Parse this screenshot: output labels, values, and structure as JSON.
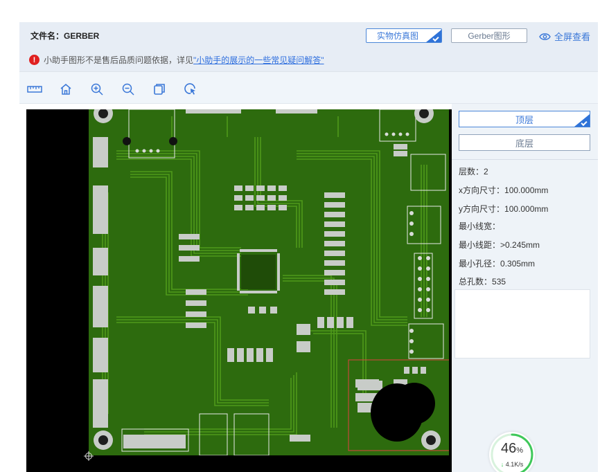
{
  "header": {
    "file_name": "文件名：GERBER",
    "notice_text": "小助手图形不是售后品质问题依据，详见",
    "notice_link": "\"小助手的展示的一些常见疑问解答\"",
    "notice_icon": "warning-icon"
  },
  "view_buttons": {
    "sim_label": "实物仿真图",
    "gerber_label": "Gerber图形",
    "fullscreen_label": "全屏查看"
  },
  "toolbar": {
    "icons": [
      "ruler-icon",
      "home-icon",
      "zoom-in-icon",
      "zoom-out-icon",
      "copy-icon",
      "pointer-refresh-icon"
    ]
  },
  "layers": {
    "top_label": "顶层",
    "bottom_label": "底层"
  },
  "info": [
    {
      "label": "层数：",
      "value": "2"
    },
    {
      "label": "x方向尺寸：",
      "value": "100.000mm"
    },
    {
      "label": "y方向尺寸：",
      "value": "100.000mm"
    },
    {
      "label": "最小线宽：",
      "value": ""
    },
    {
      "label": "最小线距：",
      "value": ">0.245mm"
    },
    {
      "label": "最小孔径：",
      "value": "0.305mm"
    },
    {
      "label": "总孔数：",
      "value": "535"
    }
  ],
  "speed": {
    "percent": "46",
    "percent_unit": "%",
    "rate": "4.1K/s",
    "progress": 0.46
  },
  "colors": {
    "accent": "#3b78d8",
    "board": "#2d6b0e",
    "trace": "#4f9a1a",
    "pad": "#c8ccc8",
    "highlight": "#e04040",
    "progress": "#3fc85a"
  }
}
